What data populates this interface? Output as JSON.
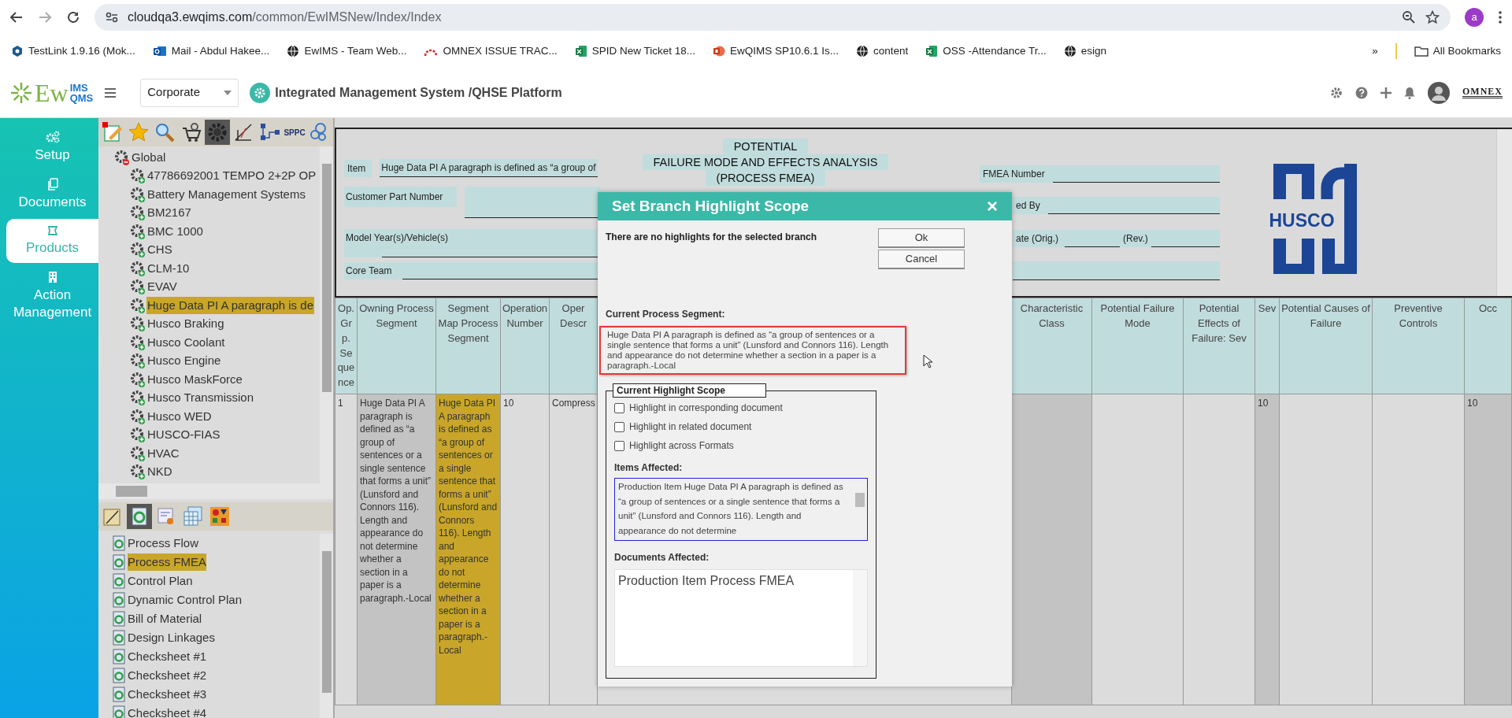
{
  "browser": {
    "address": {
      "host": "cloudqa3.ewqims.com",
      "path": "/common/EwIMSNew/Index/Index"
    },
    "profile_initial": "a",
    "bookmarks": [
      {
        "label": "TestLink 1.9.16 (Mok...",
        "kind": "testlink"
      },
      {
        "label": "Mail - Abdul Hakee...",
        "kind": "mail"
      },
      {
        "label": "EwIMS - Team Web...",
        "kind": "web"
      },
      {
        "label": "OMNEX ISSUE TRAC...",
        "kind": "tracker"
      },
      {
        "label": "SPID New Ticket 18...",
        "kind": "sheet"
      },
      {
        "label": "EwQIMS SP10.6.1 Is...",
        "kind": "slides"
      },
      {
        "label": "content",
        "kind": "web"
      },
      {
        "label": "OSS -Attendance Tr...",
        "kind": "sheet"
      },
      {
        "label": "esign",
        "kind": "web"
      }
    ],
    "bookmarks_overflow": "»",
    "all_bookmarks": "All Bookmarks"
  },
  "app_header": {
    "logo": {
      "main": "Ew",
      "top": "IMS",
      "bottom": "QMS"
    },
    "site_select": {
      "value": "Corporate"
    },
    "platform_title": "Integrated Management System /QHSE Platform",
    "brand_logo": "OMNEX"
  },
  "nav": [
    {
      "label": "Setup",
      "kind": "setup",
      "selected": false
    },
    {
      "label": "Documents",
      "kind": "documents",
      "selected": false
    },
    {
      "label": "Products",
      "kind": "products",
      "selected": true
    },
    {
      "label": "Action Management",
      "kind": "action",
      "selected": false
    }
  ],
  "tree_toolbar": {
    "sppc_label": "SPPC"
  },
  "tree": {
    "label": "Global",
    "expanded": true,
    "children": [
      {
        "label": "47786692001 TEMPO 2+2P OP",
        "expanded": false,
        "selected": false
      },
      {
        "label": "Battery Management Systems",
        "expanded": false,
        "selected": false
      },
      {
        "label": "BM2167",
        "expanded": false,
        "selected": false
      },
      {
        "label": "BMC 1000",
        "expanded": false,
        "selected": false
      },
      {
        "label": "CHS",
        "expanded": false,
        "selected": false
      },
      {
        "label": "CLM-10",
        "expanded": false,
        "selected": false
      },
      {
        "label": "EVAV",
        "expanded": false,
        "selected": false
      },
      {
        "label": "Huge Data PI A paragraph is de",
        "expanded": false,
        "selected": true
      },
      {
        "label": "Husco Braking",
        "expanded": false,
        "selected": false
      },
      {
        "label": "Husco Coolant",
        "expanded": false,
        "selected": false
      },
      {
        "label": "Husco Engine",
        "expanded": false,
        "selected": false
      },
      {
        "label": "Husco MaskForce",
        "expanded": false,
        "selected": false
      },
      {
        "label": "Husco Transmission",
        "expanded": false,
        "selected": false
      },
      {
        "label": "Husco WED",
        "expanded": false,
        "selected": false
      },
      {
        "label": "HUSCO-FIAS",
        "expanded": false,
        "selected": false
      },
      {
        "label": "HVAC",
        "expanded": false,
        "selected": false
      },
      {
        "label": "NKD",
        "expanded": false,
        "selected": false
      }
    ]
  },
  "documents": [
    {
      "label": "Process Flow",
      "selected": false
    },
    {
      "label": "Process FMEA",
      "selected": true
    },
    {
      "label": "Control Plan",
      "selected": false
    },
    {
      "label": "Dynamic Control Plan",
      "selected": false
    },
    {
      "label": "Bill of Material",
      "selected": false
    },
    {
      "label": "Design Linkages",
      "selected": false
    },
    {
      "label": "Checksheet #1",
      "selected": false
    },
    {
      "label": "Checksheet #2",
      "selected": false
    },
    {
      "label": "Checksheet #3",
      "selected": false
    },
    {
      "label": "Checksheet #4",
      "selected": false
    }
  ],
  "form": {
    "item_label": "Item",
    "item_value": "Huge Data PI A paragraph is defined as “a group of",
    "customer_part_label": "Customer Part Number",
    "model_year_label": "Model Year(s)/Vehicle(s)",
    "core_team_label": "Core Team",
    "title_lines": [
      "POTENTIAL",
      "FAILURE MODE AND EFFECTS ANALYSIS",
      "(PROCESS FMEA)"
    ],
    "fmea_number_label": "FMEA Number",
    "prepared_by_label": "ed By",
    "date_orig_label": "ate (Orig.)",
    "date_rev_label": "(Rev.)",
    "logo_text": "HUSCO"
  },
  "table": {
    "columns": [
      {
        "label": "Op. Grp. Sequence",
        "kind": "plain",
        "cell": "1"
      },
      {
        "label": "Owning Process Segment",
        "kind": "readonly",
        "cell": "Huge Data PI A paragraph is defined as “a group of sentences or a single sentence that forms a unit” (Lunsford and Connors 116). Length and appearance do not determine whether a section in a paper is a paragraph.-Local"
      },
      {
        "label": "Segment Map Process Segment",
        "kind": "highlight",
        "cell": "Huge Data PI A paragraph is defined as “a group of sentences or a single sentence that forms a unit” (Lunsford and Connors 116). Length and appearance do not determine whether a section in a paper is a paragraph.-Local"
      },
      {
        "label": "Operation Number",
        "kind": "plain",
        "cell": "10"
      },
      {
        "label": "Oper Descr",
        "kind": "plain",
        "cell": "Compress"
      },
      {
        "label": "Characteristic Class",
        "kind": "readonly"
      },
      {
        "label": "Potential Failure Mode",
        "kind": "plain"
      },
      {
        "label": "Potential Effects of Failure: Sev",
        "kind": "plain"
      },
      {
        "label": "Sev",
        "kind": "readonly",
        "cell": "10"
      },
      {
        "label": "Potential Causes of Failure",
        "kind": "plain"
      },
      {
        "label": "Preventive Controls",
        "kind": "plain"
      },
      {
        "label": "Occ",
        "kind": "readonly",
        "cell": "10"
      }
    ]
  },
  "modal": {
    "title": "Set Branch Highlight Scope",
    "close": "×",
    "message": "There are no highlights for the selected branch",
    "buttons": [
      "Ok",
      "Cancel"
    ],
    "segment_label": "Current Process Segment:",
    "segment_text": "Huge Data PI A paragraph is defined as “a group of sentences or a single sentence that forms a unit” (Lunsford and Connors 116). Length and appearance do not determine whether a section in a paper is a paragraph.-Local",
    "scope_legend": "Current Highlight Scope",
    "scope_options": [
      {
        "label": "Highlight in corresponding document",
        "checked": false
      },
      {
        "label": "Highlight in related document",
        "checked": false
      },
      {
        "label": "Highlight across Formats",
        "checked": false
      }
    ],
    "items_label": "Items Affected:",
    "items_text": "Production Item Huge Data PI A paragraph is defined as “a group of sentences or a single sentence that forms a unit” (Lunsford and Connors 116). Length and appearance do not determine",
    "documents_label": "Documents Affected:",
    "documents": [
      "Production Item Process FMEA"
    ]
  }
}
